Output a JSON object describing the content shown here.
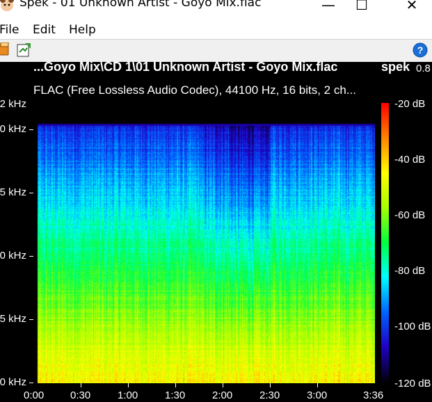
{
  "window": {
    "title": "Spek - 01 Unknown Artist - Goyo Mix.flac",
    "minimize_glyph": "—",
    "maximize_glyph": "☐",
    "close_glyph": "✕"
  },
  "menu": {
    "file": "File",
    "edit": "Edit",
    "help": "Help"
  },
  "toolbar": {
    "open_icon": "open-file-icon",
    "save_icon": "save-image-icon",
    "help_icon": "help-icon"
  },
  "plot": {
    "file_path": "...Goyo Mix\\CD 1\\01 Unknown Artist - Goyo Mix.flac",
    "app_name": "spek",
    "version": "0.8",
    "stream_info": "FLAC (Free Lossless Audio Codec), 44100 Hz, 16 bits, 2 ch...",
    "y_labels": [
      "2 kHz",
      "0 kHz",
      "5 kHz",
      "0 kHz",
      "5 kHz",
      "0 kHz"
    ],
    "x_labels": [
      "0:00",
      "0:30",
      "1:00",
      "1:30",
      "2:00",
      "2:30",
      "3:00",
      "3:36"
    ],
    "db_labels": [
      "-20 dB",
      "-40 dB",
      "-60 dB",
      "-80 dB",
      "-100 dB",
      "-120 dB"
    ],
    "palette": [
      "#000000",
      "#2000c8",
      "#0060ff",
      "#00ffff",
      "#00ff40",
      "#aaff00",
      "#ffff00",
      "#ff7f00",
      "#ff0000"
    ]
  }
}
